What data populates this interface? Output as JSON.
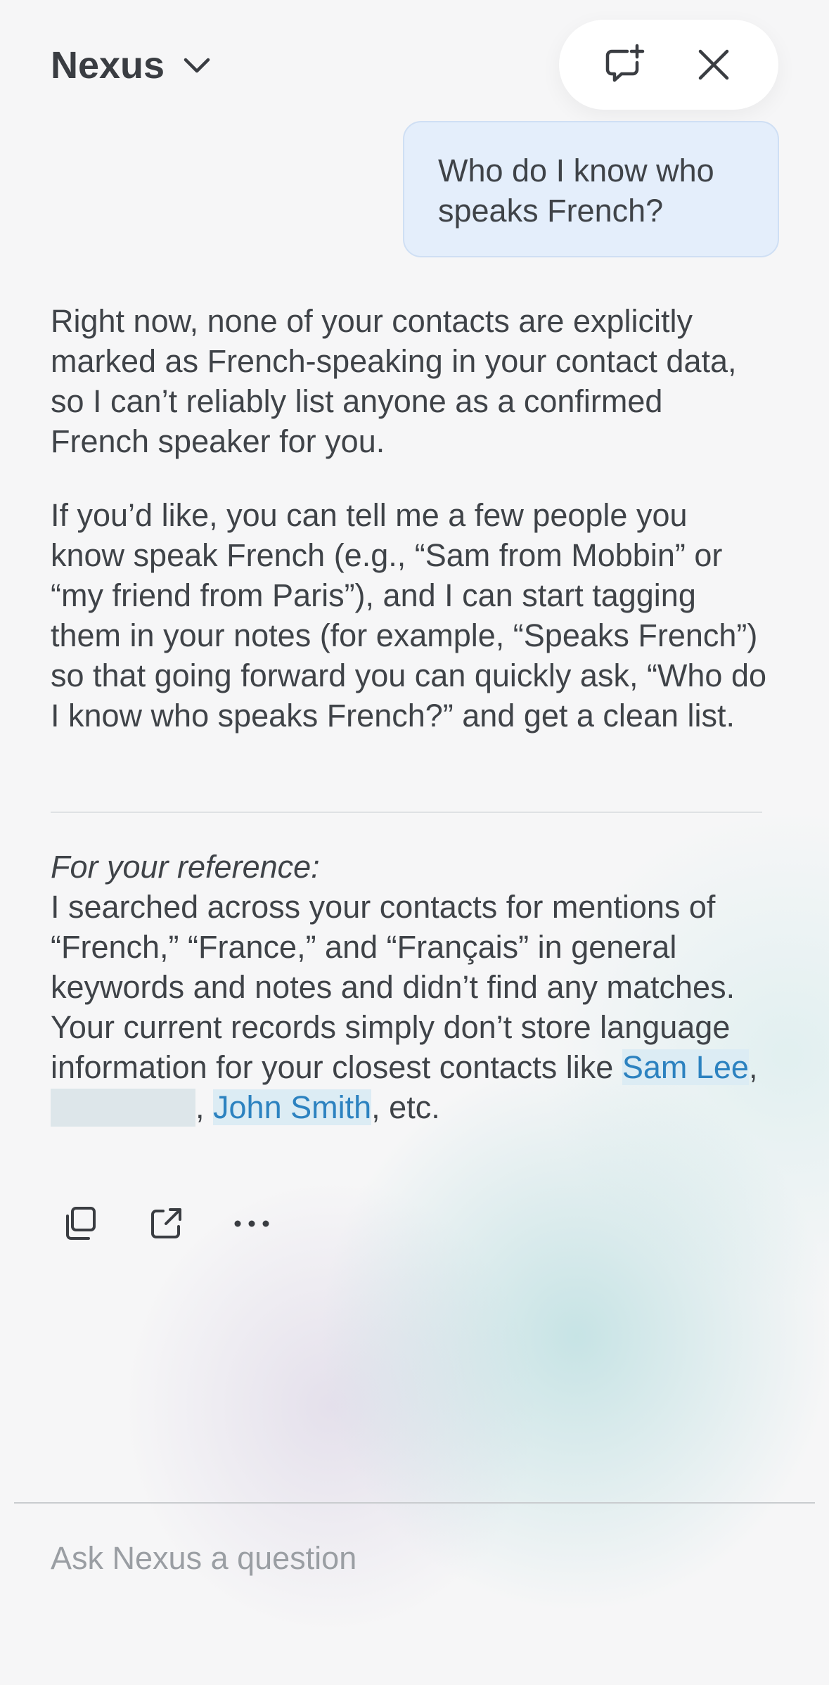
{
  "header": {
    "title": "Nexus",
    "chevron_icon": "chevron-down-icon",
    "new_chat_icon": "new-chat-icon",
    "close_icon": "close-icon"
  },
  "conversation": {
    "user_message": "Who do I know who speaks French?",
    "response_paragraphs": [
      "Right now, none of your contacts are explicitly marked as French-speaking in your contact data, so I can’t reliably list anyone as a confirmed French speaker for you.",
      "If you’d like, you can tell me a few people you know speak French (e.g., “Sam from Mobbin” or “my friend from Paris”), and I can start tagging them in your notes (for example, “Speaks French”) so that going forward you can quickly ask, “Who do I know who speaks French?” and get a clean list."
    ],
    "reference": {
      "heading": "For your reference:",
      "body": "I searched across your contacts for mentions of “French,” “France,” and “Français” in general keywords and notes and didn’t find any matches. Your current records simply don’t store language information for your closest contacts like ",
      "contacts": [
        "Sam Lee",
        "John Smith"
      ],
      "separator": ",",
      "tail": ", etc."
    }
  },
  "actions": {
    "copy_icon": "copy-icon",
    "share_icon": "share-icon",
    "more_icon": "more-icon"
  },
  "input": {
    "placeholder": "Ask Nexus a question"
  },
  "colors": {
    "user_bubble": "#e4eefb",
    "link": "#2c82c0",
    "text": "#3f4348"
  }
}
